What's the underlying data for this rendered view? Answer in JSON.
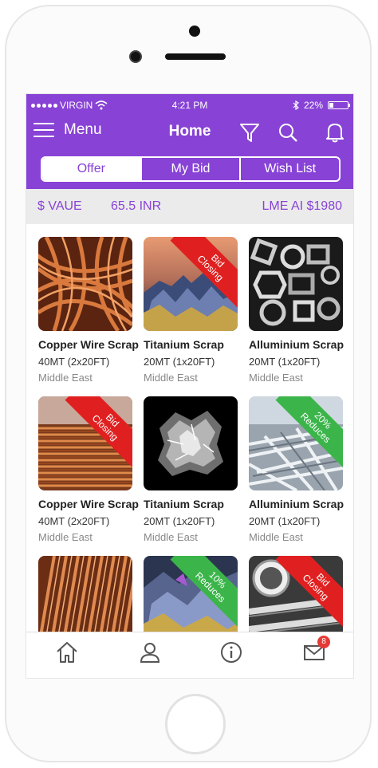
{
  "status_bar": {
    "carrier": "VIRGIN",
    "time": "4:21 PM",
    "battery": "22%",
    "battery_level": 0.22
  },
  "header": {
    "menu_label": "Menu",
    "title": "Home",
    "icons": [
      "filter-icon",
      "search-icon",
      "bell-icon"
    ]
  },
  "tabs": [
    {
      "label": "Offer",
      "active": true
    },
    {
      "label": "My Bid",
      "active": false
    },
    {
      "label": "Wish List",
      "active": false
    }
  ],
  "rates": {
    "value_label": "$ VAUE",
    "value": "65.5 INR",
    "lme": "LME AI $1980"
  },
  "products": [
    {
      "name": "Copper Wire Scrap",
      "qty": "40MT (2x20FT)",
      "location": "Middle East",
      "ribbon": "",
      "image": "copper-wire"
    },
    {
      "name": "Titanium Scrap",
      "qty": "20MT (1x20FT)",
      "location": "Middle East",
      "ribbon": "Bid Closing",
      "ribbon_color": "#e02020",
      "image": "titanium-crystal"
    },
    {
      "name": "Alluminium Scrap",
      "qty": "20MT (1x20FT)",
      "location": "Middle East",
      "ribbon": "",
      "image": "aluminium-profiles"
    },
    {
      "name": "Copper Wire Scrap",
      "qty": "40MT (2x20FT)",
      "location": "Middle East",
      "ribbon": "Bid Closing",
      "ribbon_color": "#e02020",
      "image": "copper-coil"
    },
    {
      "name": "Titanium Scrap",
      "qty": "20MT (1x20FT)",
      "location": "Middle East",
      "ribbon": "",
      "image": "titanium-chips"
    },
    {
      "name": "Alluminium Scrap",
      "qty": "20MT (1x20FT)",
      "location": "Middle East",
      "ribbon": "20% Reduces",
      "ribbon_color": "#3bb54a",
      "image": "aluminium-pile"
    },
    {
      "name": "",
      "qty": "",
      "location": "",
      "ribbon": "",
      "image": "copper-pipes"
    },
    {
      "name": "",
      "qty": "",
      "location": "",
      "ribbon": "10% Reduces",
      "ribbon_color": "#3bb54a",
      "image": "titanium-crystal-2"
    },
    {
      "name": "",
      "qty": "",
      "location": "",
      "ribbon": "Bid Closing",
      "ribbon_color": "#e02020",
      "image": "aluminium-tubes"
    }
  ],
  "bottom_nav": {
    "icons": [
      "home-icon",
      "profile-icon",
      "info-icon",
      "mail-icon"
    ],
    "mail_badge": "8"
  },
  "colors": {
    "brand": "#8843d6",
    "red_ribbon": "#e02020",
    "green_ribbon": "#3bb54a"
  }
}
